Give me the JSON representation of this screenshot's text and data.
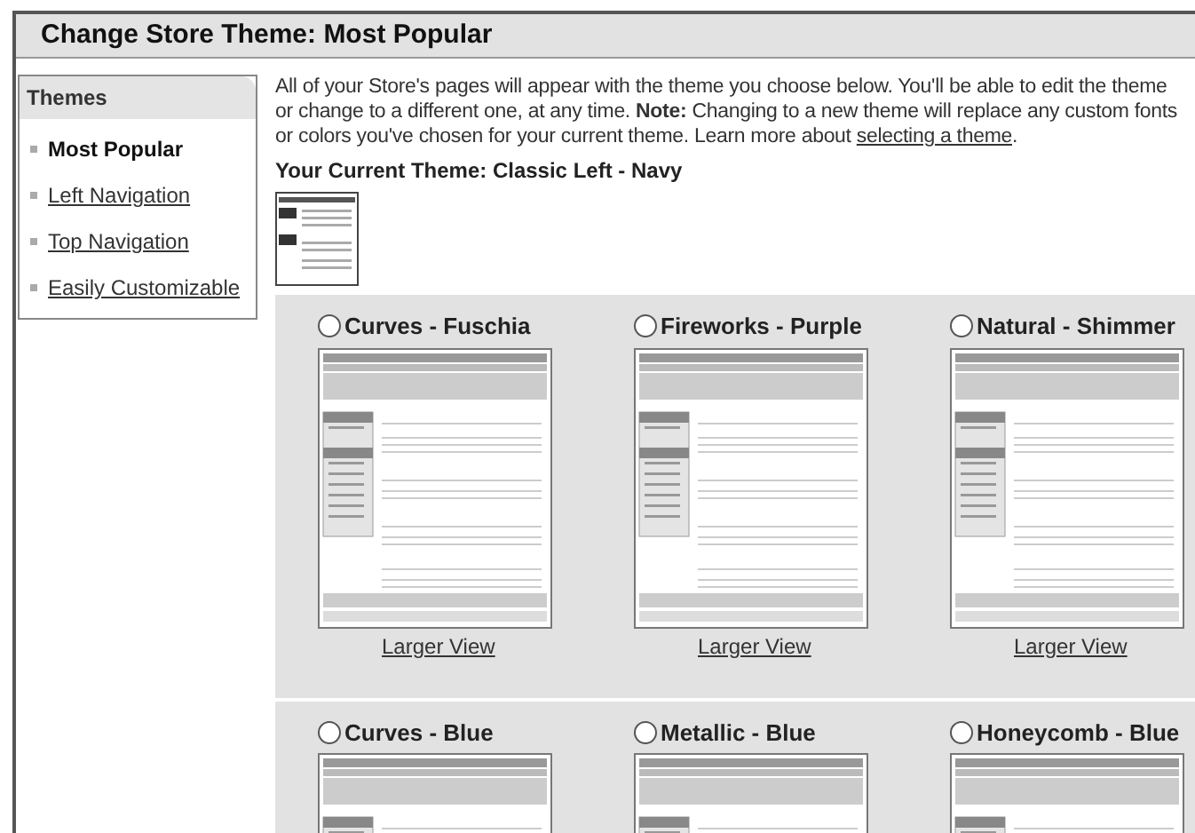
{
  "title": "Change Store Theme: Most Popular",
  "sidebar": {
    "heading": "Themes",
    "items": [
      {
        "label": "Most Popular",
        "selected": true
      },
      {
        "label": "Left Navigation",
        "selected": false
      },
      {
        "label": "Top Navigation",
        "selected": false
      },
      {
        "label": "Easily Customizable",
        "selected": false
      }
    ]
  },
  "description": {
    "lines": [
      "All of your Store's pages will appear with the theme you choose below. You'll be able to edit the theme",
      "or change to a different one, at any time. **Note:** Changing to a new theme will replace any custom fonts",
      "or colors you've chosen for your current theme. Learn more about "
    ],
    "link": "selecting a theme",
    "after": "."
  },
  "current_theme": "Your Current Theme: Classic Left - Navy",
  "theme_rows": [
    [
      {
        "name": "Curves - Fuschia",
        "selected": false,
        "larger_view": "Larger View"
      },
      {
        "name": "Fireworks - Purple",
        "selected": false,
        "larger_view": "Larger View"
      },
      {
        "name": "Natural - Shimmer",
        "selected": false,
        "larger_view": "Larger View"
      }
    ],
    [
      {
        "name": "Curves - Blue",
        "selected": false
      },
      {
        "name": "Metallic - Blue",
        "selected": false
      },
      {
        "name": "Honeycomb - Blue",
        "selected": false
      }
    ]
  ]
}
